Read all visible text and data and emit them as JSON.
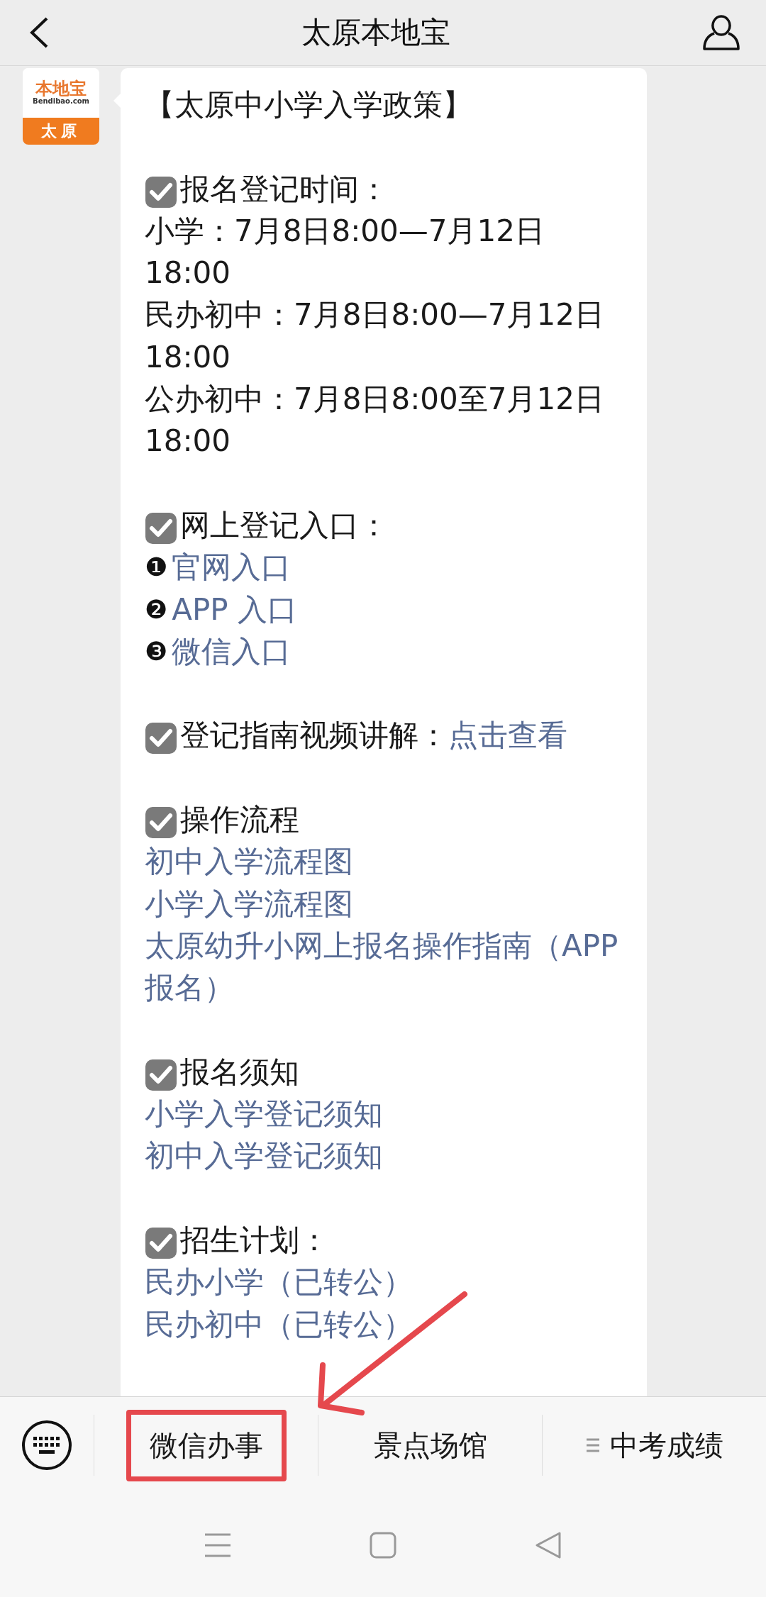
{
  "header": {
    "title": "太原本地宝"
  },
  "message": {
    "avatar": {
      "brand": "本地宝",
      "domain": "Bendibao.com",
      "city": "太原"
    },
    "blocks": [
      {
        "kind": "text",
        "text": "【太原中小学入学政策】"
      },
      {
        "kind": "gap"
      },
      {
        "kind": "heading",
        "text": "报名登记时间："
      },
      {
        "kind": "text",
        "text": "小学：7月8日8:00—7月12日18:00"
      },
      {
        "kind": "text",
        "text": "民办初中：7月8日8:00—7月12日18:00"
      },
      {
        "kind": "text",
        "text": "公办初中：7月8日8:00至7月12日18:00"
      },
      {
        "kind": "gap"
      },
      {
        "kind": "heading",
        "text": "网上登记入口："
      },
      {
        "kind": "numbered",
        "number": "❶",
        "text": "官网入口"
      },
      {
        "kind": "numbered",
        "number": "❷",
        "text": "APP 入口"
      },
      {
        "kind": "numbered",
        "number": "❸",
        "text": "微信入口"
      },
      {
        "kind": "gap"
      },
      {
        "kind": "heading",
        "text": "登记指南视频讲解：",
        "link": "点击查看"
      },
      {
        "kind": "gap"
      },
      {
        "kind": "heading",
        "text": "操作流程"
      },
      {
        "kind": "link",
        "text": "初中入学流程图"
      },
      {
        "kind": "link",
        "text": "小学入学流程图"
      },
      {
        "kind": "link",
        "text": "太原幼升小网上报名操作指南（APP 报名）"
      },
      {
        "kind": "gap"
      },
      {
        "kind": "heading",
        "text": "报名须知"
      },
      {
        "kind": "link",
        "text": "小学入学登记须知"
      },
      {
        "kind": "link",
        "text": "初中入学登记须知"
      },
      {
        "kind": "gap"
      },
      {
        "kind": "heading",
        "text": "招生计划："
      },
      {
        "kind": "link",
        "text": "民办小学（已转公）"
      },
      {
        "kind": "link",
        "text": "民办初中（已转公）"
      }
    ]
  },
  "menu": [
    {
      "label": "微信办事",
      "has_submenu": false,
      "highlighted": true
    },
    {
      "label": "景点场馆",
      "has_submenu": false,
      "highlighted": false
    },
    {
      "label": "中考成绩",
      "has_submenu": true,
      "highlighted": false
    }
  ]
}
